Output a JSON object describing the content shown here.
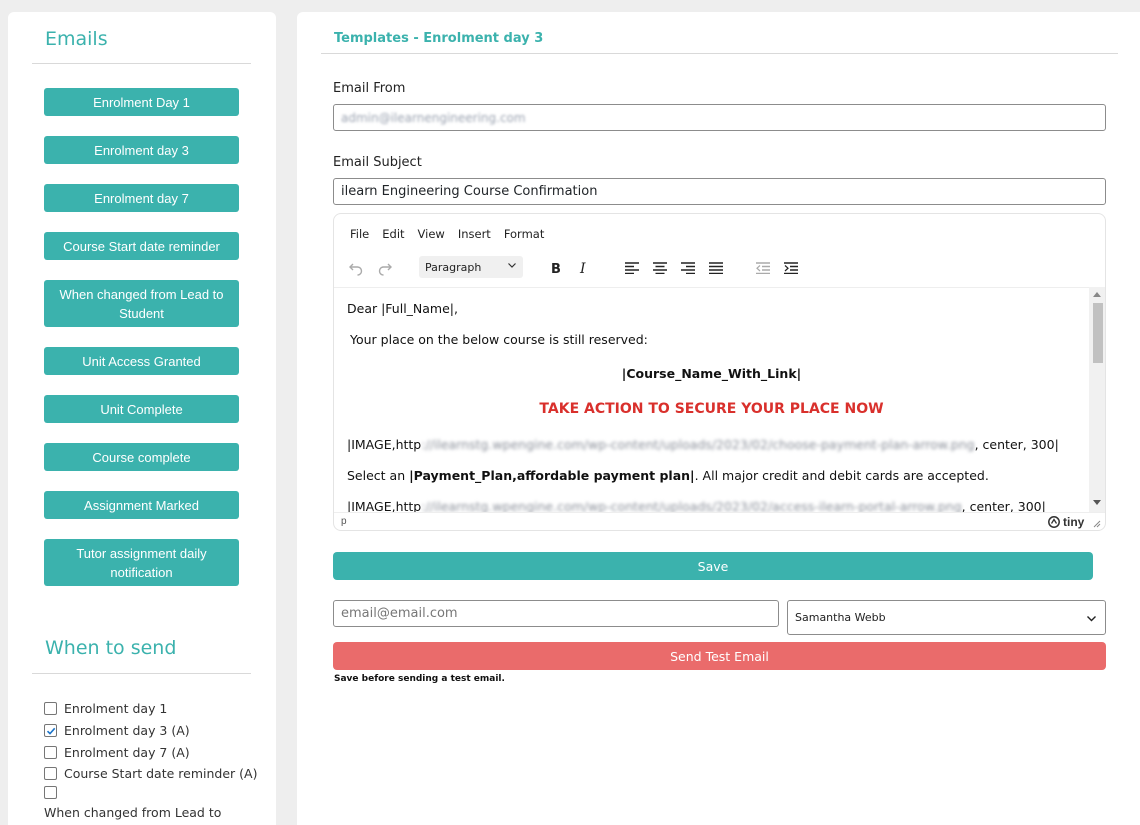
{
  "sidebar": {
    "emails_title": "Emails",
    "email_buttons": [
      "Enrolment Day 1",
      "Enrolment day 3",
      "Enrolment day 7",
      "Course Start date reminder",
      "When changed from Lead to Student",
      "Unit Access Granted",
      "Unit Complete",
      "Course complete",
      "Assignment Marked",
      "Tutor assignment daily notification"
    ],
    "when_title": "When to send",
    "when_options": [
      {
        "label": "Enrolment day 1",
        "checked": false
      },
      {
        "label": "Enrolment day 3 (A)",
        "checked": true
      },
      {
        "label": "Enrolment day 7 (A)",
        "checked": false
      },
      {
        "label": "Course Start date reminder (A)",
        "checked": false
      },
      {
        "label": "",
        "checked": false
      },
      {
        "label": "When changed from Lead to",
        "checked": false
      }
    ]
  },
  "main": {
    "title": "Templates - Enrolment day 3",
    "email_from_label": "Email From",
    "email_from_value": "admin@ilearnengineering.com",
    "email_subject_label": "Email Subject",
    "email_subject_value": "ilearn Engineering Course Confirmation",
    "editor": {
      "menu": [
        "File",
        "Edit",
        "View",
        "Insert",
        "Format"
      ],
      "block_format": "Paragraph",
      "content": {
        "greeting": "Dear |Full_Name|,",
        "reserved": "Your place on the below course is still reserved:",
        "course_link": "|Course_Name_With_Link|",
        "cta": "TAKE ACTION TO SECURE YOUR PLACE NOW",
        "image1_prefix": "|IMAGE,http",
        "image1_url": "://ilearnstg.wpengine.com/wp-content/uploads/2023/02/choose-payment-plan-arrow.png",
        "image1_suffix": ", center, 300|",
        "select_prefix": "Select an ",
        "select_bold": "|Payment_Plan,affordable payment plan|",
        "select_suffix": ". All major credit and debit cards are accepted.",
        "image2_prefix": "|IMAGE,http",
        "image2_url": "://ilearnstg.wpengine.com/wp-content/uploads/2023/02/access-ilearn-portal-arrow.png",
        "image2_suffix": ", center, 300|"
      },
      "status_path": "p",
      "brand": "tiny"
    },
    "save_label": "Save",
    "test_email_placeholder": "email@email.com",
    "test_user": "Samantha Webb",
    "send_test_label": "Send Test Email",
    "hint": "Save before sending a test email."
  },
  "colors": {
    "accent": "#3bb2ad",
    "danger": "#ea6b6b",
    "cta_red": "#d9302c"
  }
}
